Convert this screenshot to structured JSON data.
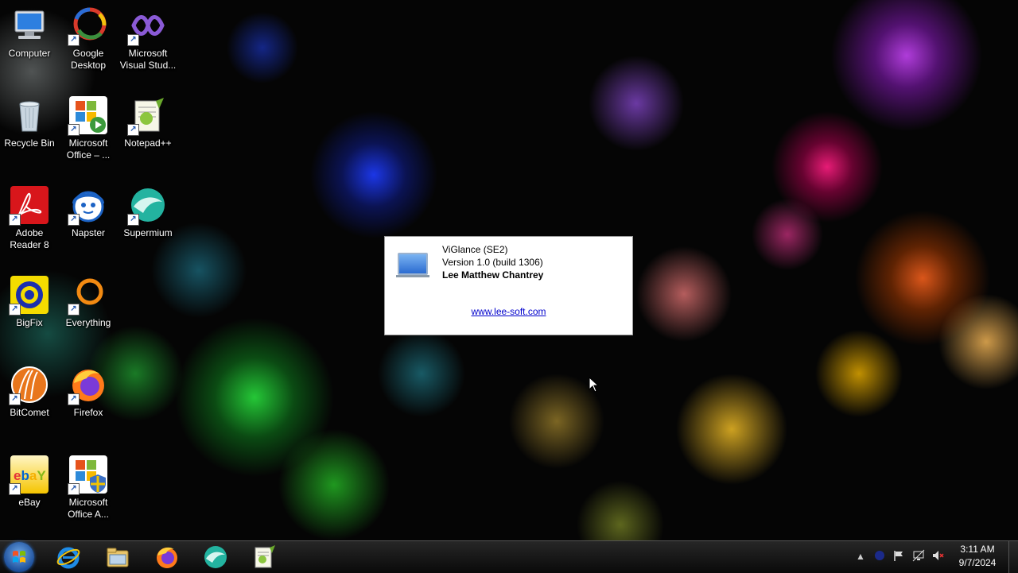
{
  "desktop_icons": [
    {
      "label": "Computer"
    },
    {
      "label": "Google Desktop"
    },
    {
      "label": "Microsoft Visual Stud..."
    },
    {
      "label": "Recycle Bin"
    },
    {
      "label": "Microsoft Office – ..."
    },
    {
      "label": "Notepad++"
    },
    {
      "label": "Adobe Reader 8"
    },
    {
      "label": "Napster"
    },
    {
      "label": "Supermium"
    },
    {
      "label": "BigFix"
    },
    {
      "label": "Everything"
    },
    {
      "label": "BitComet"
    },
    {
      "label": "Firefox"
    },
    {
      "label": "eBay"
    },
    {
      "label": "Microsoft Office A..."
    }
  ],
  "dialog": {
    "app_name": "ViGlance (SE2)",
    "version": "Version 1.0 (build 1306)",
    "author": "Lee Matthew Chantrey",
    "link": "www.lee-soft.com"
  },
  "taskbar": {
    "pinned": [
      {
        "icon": "internet-explorer-icon"
      },
      {
        "icon": "file-explorer-icon"
      },
      {
        "icon": "firefox-icon"
      },
      {
        "icon": "supermium-icon"
      },
      {
        "icon": "notepad-plus-plus-icon"
      }
    ],
    "clock": {
      "time": "3:11 AM",
      "date": "9/7/2024"
    }
  }
}
